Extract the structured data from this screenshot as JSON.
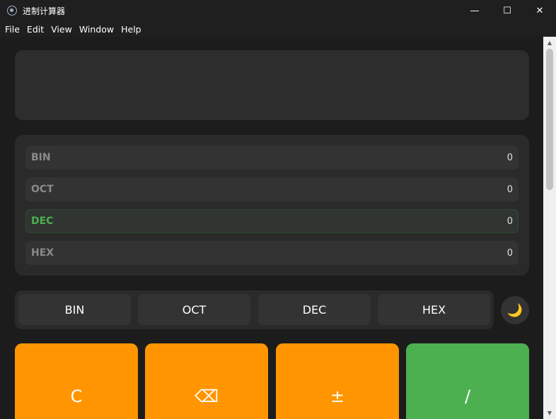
{
  "window": {
    "title": "进制计算器",
    "controls": {
      "minimize": "—",
      "maximize": "☐",
      "close": "✕"
    }
  },
  "menu": [
    "File",
    "Edit",
    "View",
    "Window",
    "Help"
  ],
  "display": {
    "value": ""
  },
  "bases": [
    {
      "label": "BIN",
      "value": "0",
      "active": false
    },
    {
      "label": "OCT",
      "value": "0",
      "active": false
    },
    {
      "label": "DEC",
      "value": "0",
      "active": true
    },
    {
      "label": "HEX",
      "value": "0",
      "active": false
    }
  ],
  "modes": [
    "BIN",
    "OCT",
    "DEC",
    "HEX"
  ],
  "theme_toggle": {
    "icon": "moon-icon",
    "glyph": "🌙"
  },
  "keys": [
    {
      "label": "C",
      "color": "orange"
    },
    {
      "label": "⌫",
      "color": "orange"
    },
    {
      "label": "±",
      "color": "orange"
    },
    {
      "label": "/",
      "color": "green"
    }
  ],
  "colors": {
    "accent_green": "#4caf50",
    "accent_orange": "#ff9500",
    "background": "#1c1c1c",
    "panel": "#2a2a2a"
  },
  "scrollbar": {
    "up": "▲",
    "down": "▼"
  }
}
